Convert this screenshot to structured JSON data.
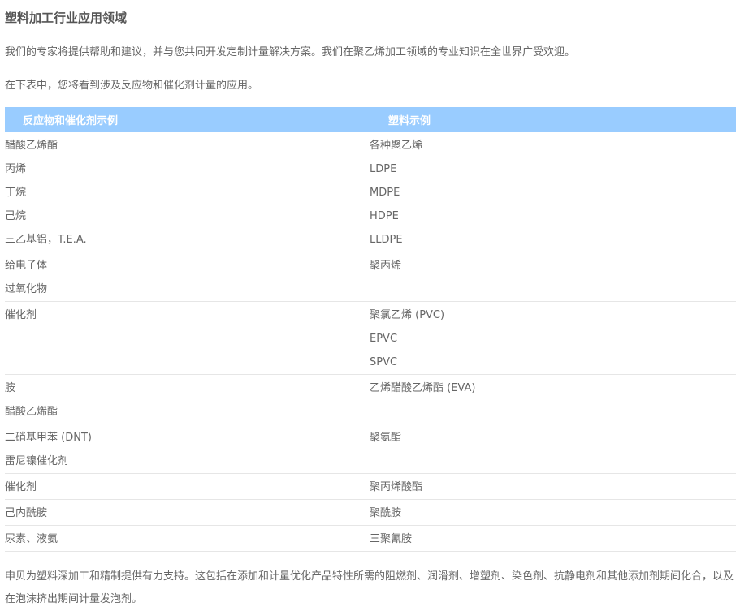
{
  "page": {
    "title": "塑料加工行业应用领域",
    "intro": "我们的专家将提供帮助和建议，并与您共同开发定制计量解决方案。我们在聚乙烯加工领域的专业知识在全世界广受欢迎。",
    "intro2": "在下表中，您将看到涉及反应物和催化剂计量的应用。",
    "footer": "申贝为塑料深加工和精制提供有力支持。这包括在添加和计量优化产品特性所需的阻燃剂、润滑剂、增塑剂、染色剂、抗静电剂和其他添加剂期间化合，以及在泡沫挤出期间计量发泡剂。"
  },
  "table": {
    "headers": [
      "反应物和催化剂示例",
      "塑料示例"
    ],
    "groups": [
      {
        "left": [
          "醋酸乙烯酯",
          "丙烯",
          "丁烷",
          "己烷",
          "三乙基铝，T.E.A."
        ],
        "right": [
          "各种聚乙烯",
          "LDPE",
          "MDPE",
          "HDPE",
          "LLDPE"
        ]
      },
      {
        "left": [
          "给电子体",
          "过氧化物"
        ],
        "right": [
          "聚丙烯"
        ]
      },
      {
        "left": [
          "催化剂"
        ],
        "right": [
          "聚氯乙烯 (PVC)",
          "EPVC",
          "SPVC"
        ]
      },
      {
        "left": [
          "胺",
          "醋酸乙烯酯"
        ],
        "right": [
          "乙烯醋酸乙烯酯 (EVA)"
        ]
      },
      {
        "left": [
          "二硝基甲苯 (DNT)",
          "雷尼镍催化剂"
        ],
        "right": [
          "聚氨酯"
        ]
      },
      {
        "left": [
          "催化剂"
        ],
        "right": [
          "聚丙烯酸酯"
        ]
      },
      {
        "left": [
          "己内酰胺"
        ],
        "right": [
          "聚酰胺"
        ]
      },
      {
        "left": [
          "尿素、液氨"
        ],
        "right": [
          "三聚氰胺"
        ]
      }
    ]
  },
  "colors": {
    "header_bg": "#99ccff",
    "header_text": "#ffffff",
    "body_text": "#666666",
    "divider": "#e6e6e6"
  }
}
